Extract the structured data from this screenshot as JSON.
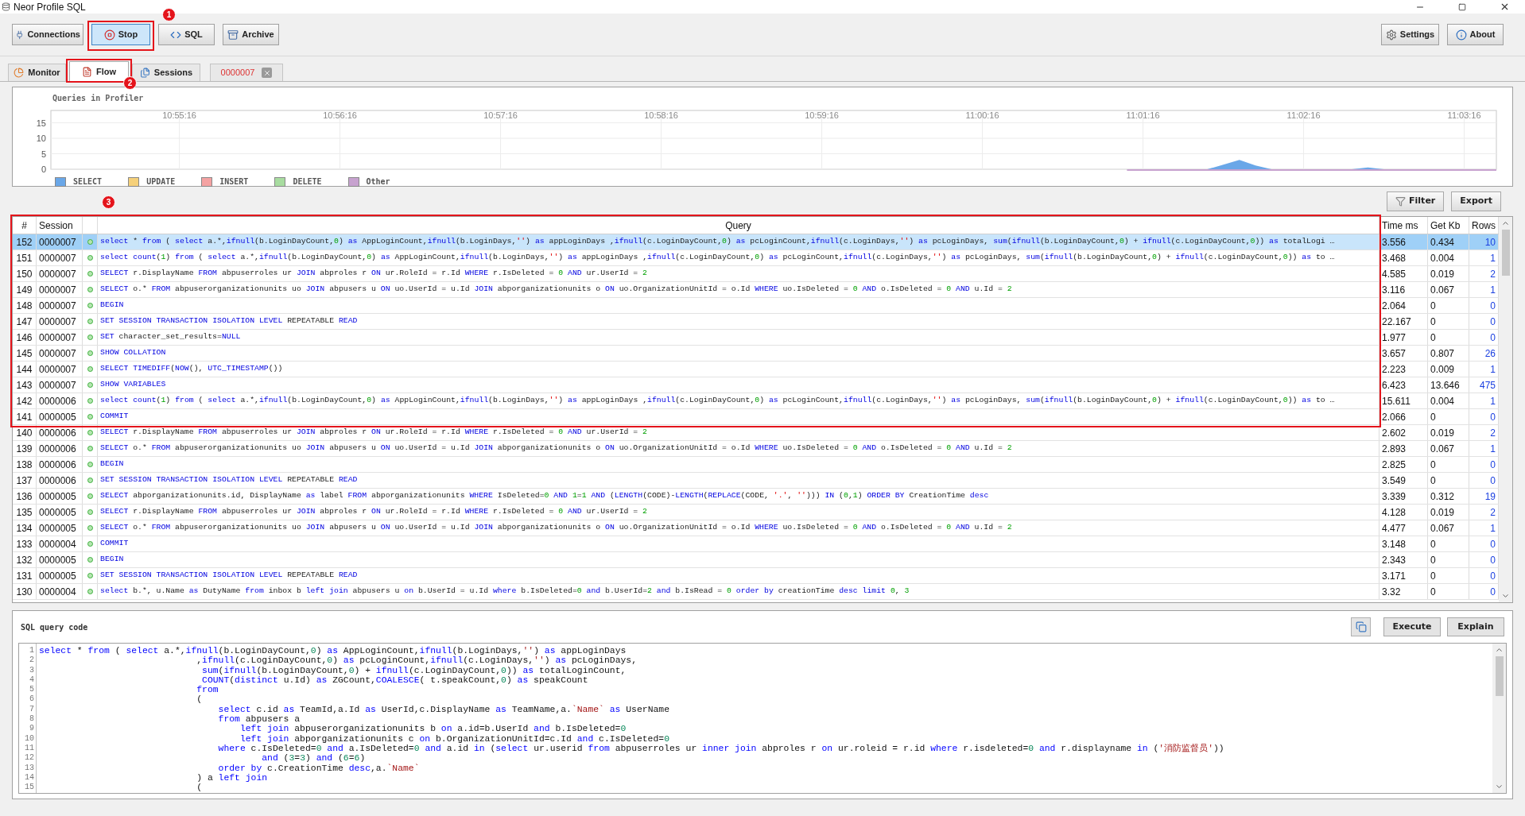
{
  "window": {
    "title": "Neor Profile SQL"
  },
  "toolbar": {
    "left": [
      {
        "label": "Connections",
        "pressed": false
      },
      {
        "label": "Stop",
        "pressed": true
      },
      {
        "label": "SQL",
        "pressed": false
      },
      {
        "label": "Archive",
        "pressed": false
      }
    ],
    "right": [
      {
        "label": "Settings",
        "pressed": false
      },
      {
        "label": "About",
        "pressed": false
      }
    ]
  },
  "tabs": [
    {
      "label": "Monitor",
      "selected": false,
      "closable": false
    },
    {
      "label": "Flow",
      "selected": true,
      "closable": false
    },
    {
      "label": "Sessions",
      "selected": false,
      "closable": false
    },
    {
      "label": "0000007",
      "selected": false,
      "closable": true
    }
  ],
  "chart": {
    "title": "Queries in Profiler",
    "chart_data": {
      "type": "area",
      "grid": true,
      "ylim": [
        0,
        19
      ],
      "yticks": [
        0,
        5,
        10,
        15
      ],
      "categories": [
        null,
        null,
        null,
        null,
        null,
        null,
        null,
        null,
        "10:55:16",
        null,
        null,
        null,
        null,
        null,
        null,
        null,
        null,
        null,
        "10:56:16",
        null,
        null,
        null,
        null,
        null,
        null,
        null,
        null,
        null,
        "10:57:16",
        null,
        null,
        null,
        null,
        null,
        null,
        null,
        null,
        null,
        "10:58:16",
        null,
        null,
        null,
        null,
        null,
        null,
        null,
        null,
        null,
        "10:59:16",
        null,
        null,
        null,
        null,
        null,
        null,
        null,
        null,
        null,
        "11:00:16",
        null,
        null,
        null,
        null,
        null,
        null,
        null,
        null,
        null,
        "11:01:16",
        null,
        null,
        null,
        null,
        null,
        null,
        null,
        null,
        null,
        "11:02:16",
        null,
        null,
        null,
        null,
        null,
        null,
        null,
        null,
        null,
        "11:03:16",
        null,
        null
      ],
      "series": [
        {
          "name": "SELECT",
          "color": "#6aa7e8",
          "values": [
            null,
            null,
            null,
            null,
            null,
            null,
            null,
            null,
            null,
            null,
            null,
            null,
            null,
            null,
            null,
            null,
            null,
            null,
            null,
            null,
            null,
            null,
            null,
            null,
            null,
            null,
            null,
            null,
            null,
            null,
            null,
            null,
            null,
            null,
            null,
            null,
            null,
            null,
            null,
            null,
            null,
            null,
            null,
            null,
            null,
            null,
            null,
            null,
            null,
            null,
            null,
            null,
            null,
            null,
            null,
            null,
            null,
            null,
            null,
            null,
            null,
            null,
            null,
            null,
            null,
            null,
            null,
            null,
            null,
            null,
            null,
            null,
            0,
            1.5,
            3,
            1.2,
            0,
            null,
            null,
            null,
            null,
            0,
            0.6,
            0,
            null,
            null,
            null,
            null,
            null,
            null,
            null
          ]
        },
        {
          "name": "UPDATE",
          "color": "#f5d07a",
          "values": [
            null,
            null,
            null,
            null,
            null,
            null,
            null,
            null,
            null,
            null,
            null,
            null,
            null,
            null,
            null,
            null,
            null,
            null,
            null,
            null,
            null,
            null,
            null,
            null,
            null,
            null,
            null,
            null,
            null,
            null,
            null,
            null,
            null,
            null,
            null,
            null,
            null,
            null,
            null,
            null,
            null,
            null,
            null,
            null,
            null,
            null,
            null,
            null,
            null,
            null,
            null,
            null,
            null,
            null,
            null,
            null,
            null,
            null,
            null,
            null,
            null,
            null,
            null,
            null,
            null,
            null,
            null,
            null,
            null,
            null,
            null,
            null,
            null,
            null,
            null,
            null,
            null,
            null,
            null,
            null,
            null,
            null,
            null,
            null,
            null,
            null,
            null,
            null,
            null,
            null,
            null
          ]
        },
        {
          "name": "INSERT",
          "color": "#f4a2a2",
          "values": [
            null,
            null,
            null,
            null,
            null,
            null,
            null,
            null,
            null,
            null,
            null,
            null,
            null,
            null,
            null,
            null,
            null,
            null,
            null,
            null,
            null,
            null,
            null,
            null,
            null,
            null,
            null,
            null,
            null,
            null,
            null,
            null,
            null,
            null,
            null,
            null,
            null,
            null,
            null,
            null,
            null,
            null,
            null,
            null,
            null,
            null,
            null,
            null,
            null,
            null,
            null,
            null,
            null,
            null,
            null,
            null,
            null,
            null,
            null,
            null,
            null,
            null,
            null,
            null,
            null,
            null,
            null,
            null,
            null,
            null,
            null,
            null,
            null,
            null,
            null,
            null,
            null,
            null,
            null,
            null,
            null,
            null,
            null,
            null,
            null,
            null,
            null,
            null,
            null,
            null,
            null
          ]
        },
        {
          "name": "DELETE",
          "color": "#a8dca0",
          "values": [
            null,
            null,
            null,
            null,
            null,
            null,
            null,
            null,
            null,
            null,
            null,
            null,
            null,
            null,
            null,
            null,
            null,
            null,
            null,
            null,
            null,
            null,
            null,
            null,
            null,
            null,
            null,
            null,
            null,
            null,
            null,
            null,
            null,
            null,
            null,
            null,
            null,
            null,
            null,
            null,
            null,
            null,
            null,
            null,
            null,
            null,
            null,
            null,
            null,
            null,
            null,
            null,
            null,
            null,
            null,
            null,
            null,
            null,
            null,
            null,
            null,
            null,
            null,
            null,
            null,
            null,
            null,
            null,
            null,
            null,
            null,
            null,
            null,
            null,
            null,
            null,
            null,
            null,
            null,
            null,
            null,
            null,
            null,
            null,
            null,
            null,
            null,
            null,
            null,
            null,
            null
          ]
        },
        {
          "name": "Other",
          "color": "#c7a2cf",
          "values": [
            null,
            null,
            null,
            null,
            null,
            null,
            null,
            null,
            null,
            null,
            null,
            null,
            null,
            null,
            null,
            null,
            null,
            null,
            null,
            null,
            null,
            null,
            null,
            null,
            null,
            null,
            null,
            null,
            null,
            null,
            null,
            null,
            null,
            null,
            null,
            null,
            null,
            null,
            null,
            null,
            null,
            null,
            null,
            null,
            null,
            null,
            null,
            null,
            null,
            null,
            null,
            null,
            null,
            null,
            null,
            null,
            null,
            null,
            null,
            null,
            null,
            null,
            null,
            null,
            null,
            null,
            null,
            0,
            0,
            0,
            0,
            0,
            0,
            0,
            0,
            0,
            0,
            0,
            0,
            0,
            0,
            0,
            0,
            0,
            0,
            0,
            0,
            0,
            0,
            0,
            0
          ]
        }
      ]
    }
  },
  "table_actions": [
    "Filter",
    "Export"
  ],
  "table": {
    "columns": [
      "#",
      "Session",
      "Query",
      "Time ms",
      "Get Kb",
      "Rows"
    ],
    "rows": [
      {
        "id": "152",
        "session": "0000007",
        "query": "select * from ( select a.*,ifnull(b.LoginDayCount,0) as AppLoginCount,ifnull(b.LoginDays,'') as appLoginDays ,ifnull(c.LoginDayCount,0) as pcLoginCount,ifnull(c.LoginDays,'') as pcLoginDays, sum(ifnull(b.LoginDayCount,0) + ifnull(c.LoginDayCount,0)) as totalLogi …",
        "time_ms": "3.556",
        "get_kb": "0.434",
        "rows": "10",
        "selected": true
      },
      {
        "id": "151",
        "session": "0000007",
        "query": "select count(1) from ( select a.*,ifnull(b.LoginDayCount,0) as AppLoginCount,ifnull(b.LoginDays,'') as appLoginDays ,ifnull(c.LoginDayCount,0) as pcLoginCount,ifnull(c.LoginDays,'') as pcLoginDays, sum(ifnull(b.LoginDayCount,0) + ifnull(c.LoginDayCount,0)) as to …",
        "time_ms": "3.468",
        "get_kb": "0.004",
        "rows": "1",
        "selected": false
      },
      {
        "id": "150",
        "session": "0000007",
        "query": "SELECT r.DisplayName FROM abpuserroles ur JOIN abproles r ON ur.RoleId = r.Id WHERE r.IsDeleted = 0 AND ur.UserId = 2",
        "time_ms": "4.585",
        "get_kb": "0.019",
        "rows": "2",
        "selected": false
      },
      {
        "id": "149",
        "session": "0000007",
        "query": "SELECT o.* FROM abpuserorganizationunits uo JOIN abpusers u ON uo.UserId = u.Id JOIN abporganizationunits o ON uo.OrganizationUnitId = o.Id WHERE uo.IsDeleted = 0 AND o.IsDeleted = 0 AND u.Id = 2",
        "time_ms": "3.116",
        "get_kb": "0.067",
        "rows": "1",
        "selected": false
      },
      {
        "id": "148",
        "session": "0000007",
        "query": "BEGIN",
        "time_ms": "2.064",
        "get_kb": "0",
        "rows": "0",
        "selected": false
      },
      {
        "id": "147",
        "session": "0000007",
        "query": "SET SESSION TRANSACTION ISOLATION LEVEL REPEATABLE READ",
        "time_ms": "22.167",
        "get_kb": "0",
        "rows": "0",
        "selected": false
      },
      {
        "id": "146",
        "session": "0000007",
        "query": "SET character_set_results=NULL",
        "time_ms": "1.977",
        "get_kb": "0",
        "rows": "0",
        "selected": false
      },
      {
        "id": "145",
        "session": "0000007",
        "query": "SHOW COLLATION",
        "time_ms": "3.657",
        "get_kb": "0.807",
        "rows": "26",
        "selected": false
      },
      {
        "id": "144",
        "session": "0000007",
        "query": "SELECT TIMEDIFF(NOW(), UTC_TIMESTAMP())",
        "time_ms": "2.223",
        "get_kb": "0.009",
        "rows": "1",
        "selected": false
      },
      {
        "id": "143",
        "session": "0000007",
        "query": "SHOW VARIABLES",
        "time_ms": "6.423",
        "get_kb": "13.646",
        "rows": "475",
        "selected": false
      },
      {
        "id": "142",
        "session": "0000006",
        "query": "select count(1) from ( select a.*,ifnull(b.LoginDayCount,0) as AppLoginCount,ifnull(b.LoginDays,'') as appLoginDays ,ifnull(c.LoginDayCount,0) as pcLoginCount,ifnull(c.LoginDays,'') as pcLoginDays, sum(ifnull(b.LoginDayCount,0) + ifnull(c.LoginDayCount,0)) as to …",
        "time_ms": "15.611",
        "get_kb": "0.004",
        "rows": "1",
        "selected": false
      },
      {
        "id": "141",
        "session": "0000005",
        "query": "COMMIT",
        "time_ms": "2.066",
        "get_kb": "0",
        "rows": "0",
        "selected": false
      },
      {
        "id": "140",
        "session": "0000006",
        "query": "SELECT r.DisplayName FROM abpuserroles ur JOIN abproles r ON ur.RoleId = r.Id WHERE r.IsDeleted = 0 AND ur.UserId = 2",
        "time_ms": "2.602",
        "get_kb": "0.019",
        "rows": "2",
        "selected": false
      },
      {
        "id": "139",
        "session": "0000006",
        "query": "SELECT o.* FROM abpuserorganizationunits uo JOIN abpusers u ON uo.UserId = u.Id JOIN abporganizationunits o ON uo.OrganizationUnitId = o.Id WHERE uo.IsDeleted = 0 AND o.IsDeleted = 0 AND u.Id = 2",
        "time_ms": "2.893",
        "get_kb": "0.067",
        "rows": "1",
        "selected": false
      },
      {
        "id": "138",
        "session": "0000006",
        "query": "BEGIN",
        "time_ms": "2.825",
        "get_kb": "0",
        "rows": "0",
        "selected": false
      },
      {
        "id": "137",
        "session": "0000006",
        "query": "SET SESSION TRANSACTION ISOLATION LEVEL REPEATABLE READ",
        "time_ms": "3.549",
        "get_kb": "0",
        "rows": "0",
        "selected": false
      },
      {
        "id": "136",
        "session": "0000005",
        "query": "SELECT abporganizationunits.id, DisplayName as label FROM abporganizationunits WHERE IsDeleted=0 AND 1=1 AND (LENGTH(CODE)-LENGTH(REPLACE(CODE, '.', ''))) IN (0,1) ORDER BY CreationTime desc",
        "time_ms": "3.339",
        "get_kb": "0.312",
        "rows": "19",
        "selected": false
      },
      {
        "id": "135",
        "session": "0000005",
        "query": "SELECT r.DisplayName FROM abpuserroles ur JOIN abproles r ON ur.RoleId = r.Id WHERE r.IsDeleted = 0 AND ur.UserId = 2",
        "time_ms": "4.128",
        "get_kb": "0.019",
        "rows": "2",
        "selected": false
      },
      {
        "id": "134",
        "session": "0000005",
        "query": "SELECT o.* FROM abpuserorganizationunits uo JOIN abpusers u ON uo.UserId = u.Id JOIN abporganizationunits o ON uo.OrganizationUnitId = o.Id WHERE uo.IsDeleted = 0 AND o.IsDeleted = 0 AND u.Id = 2",
        "time_ms": "4.477",
        "get_kb": "0.067",
        "rows": "1",
        "selected": false
      },
      {
        "id": "133",
        "session": "0000004",
        "query": "COMMIT",
        "time_ms": "3.148",
        "get_kb": "0",
        "rows": "0",
        "selected": false
      },
      {
        "id": "132",
        "session": "0000005",
        "query": "BEGIN",
        "time_ms": "2.343",
        "get_kb": "0",
        "rows": "0",
        "selected": false
      },
      {
        "id": "131",
        "session": "0000005",
        "query": "SET SESSION TRANSACTION ISOLATION LEVEL REPEATABLE READ",
        "time_ms": "3.171",
        "get_kb": "0",
        "rows": "0",
        "selected": false
      },
      {
        "id": "130",
        "session": "0000004",
        "query": "select b.*, u.Name as DutyName from inbox b left join abpusers u on b.UserId = u.Id where b.IsDeleted=0 and b.UserId=2 and b.IsRead = 0 order by creationTime desc limit 0, 3",
        "time_ms": "3.32",
        "get_kb": "0",
        "rows": "0",
        "selected": false
      }
    ]
  },
  "sql_panel": {
    "title": "SQL query code",
    "buttons": [
      "Execute",
      "Explain"
    ],
    "lines": [
      {
        "number": "1",
        "code": "select * from ( select a.*,ifnull(b.LoginDayCount,0) as AppLoginCount,ifnull(b.LoginDays,'') as appLoginDays"
      },
      {
        "number": "2",
        "code": "                             ,ifnull(c.LoginDayCount,0) as pcLoginCount,ifnull(c.LoginDays,'') as pcLoginDays,"
      },
      {
        "number": "3",
        "code": "                              sum(ifnull(b.LoginDayCount,0) + ifnull(c.LoginDayCount,0)) as totalLoginCount,"
      },
      {
        "number": "4",
        "code": "                              COUNT(distinct u.Id) as ZGCount,COALESCE( t.speakCount,0) as speakCount"
      },
      {
        "number": "5",
        "code": "                             from"
      },
      {
        "number": "6",
        "code": "                             ("
      },
      {
        "number": "7",
        "code": "                                 select c.id as TeamId,a.Id as UserId,c.DisplayName as TeamName,a.`Name` as UserName"
      },
      {
        "number": "8",
        "code": "                                 from abpusers a"
      },
      {
        "number": "9",
        "code": "                                     left join abpuserorganizationunits b on a.id=b.UserId and b.IsDeleted=0"
      },
      {
        "number": "10",
        "code": "                                     left join abporganizationunits c on b.OrganizationUnitId=c.Id and c.IsDeleted=0"
      },
      {
        "number": "11",
        "code": "                                 where c.IsDeleted=0 and a.IsDeleted=0 and a.id in (select ur.userid from abpuserroles ur inner join abproles r on ur.roleid = r.id where r.isdeleted=0 and r.displayname in ('消防监督员'))"
      },
      {
        "number": "12",
        "code": "                                         and (3=3) and (6=6)"
      },
      {
        "number": "13",
        "code": "                                 order by c.CreationTime desc,a.`Name`"
      },
      {
        "number": "14",
        "code": "                             ) a left join"
      },
      {
        "number": "15",
        "code": "                             ("
      }
    ]
  },
  "annotations": [
    {
      "number": "1"
    },
    {
      "number": "2"
    },
    {
      "number": "3"
    }
  ]
}
